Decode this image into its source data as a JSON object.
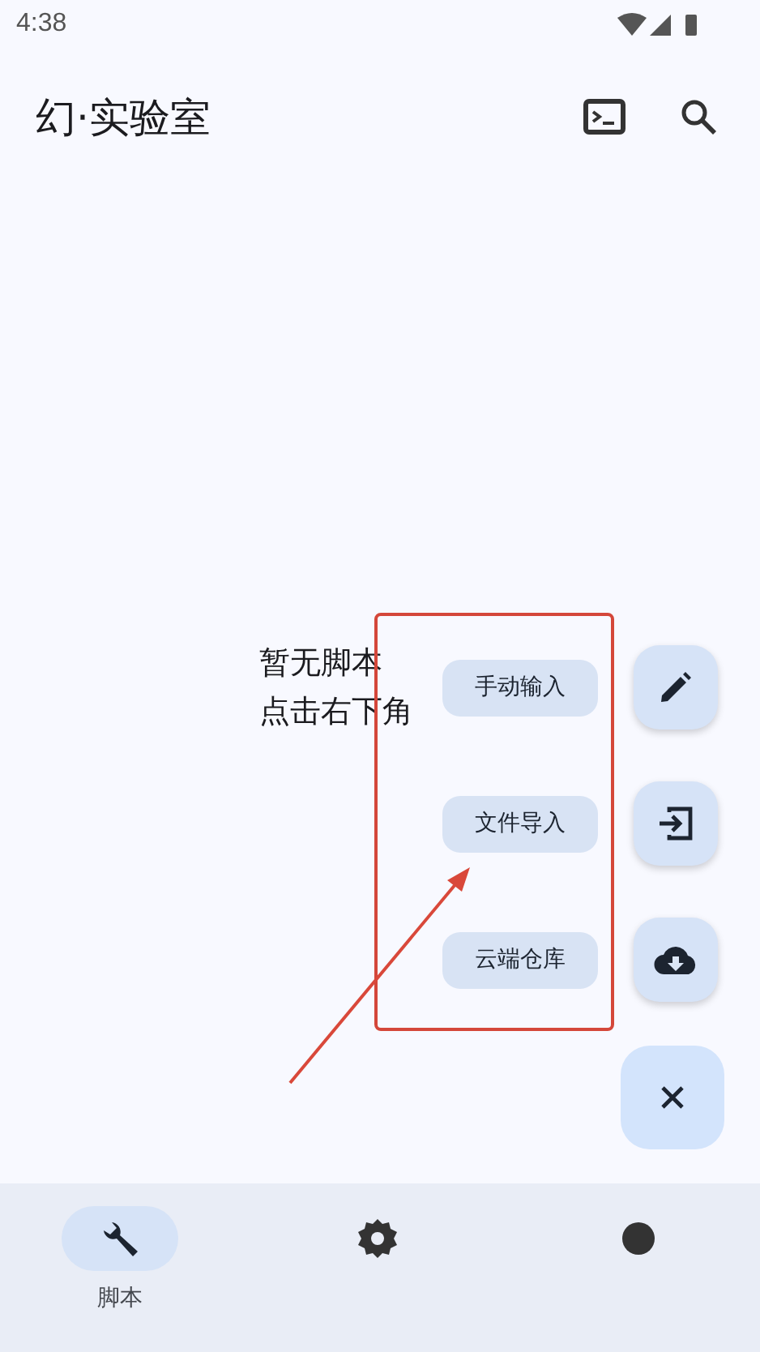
{
  "status_bar": {
    "time": "4:38"
  },
  "app_bar": {
    "title": "幻·实验室"
  },
  "empty_state": {
    "lines": [
      "暂无脚本",
      "点击右下角"
    ]
  },
  "fab_menu": {
    "options": [
      {
        "kind": "edit",
        "label": "手动输入"
      },
      {
        "kind": "import",
        "label": "文件导入"
      },
      {
        "kind": "cloud",
        "label": "云端仓库"
      }
    ]
  },
  "bottom_nav": [
    {
      "kind": "wrench",
      "label": "脚本",
      "selected": true
    },
    {
      "kind": "gear",
      "selected": false
    },
    {
      "kind": "other",
      "selected": false
    }
  ]
}
